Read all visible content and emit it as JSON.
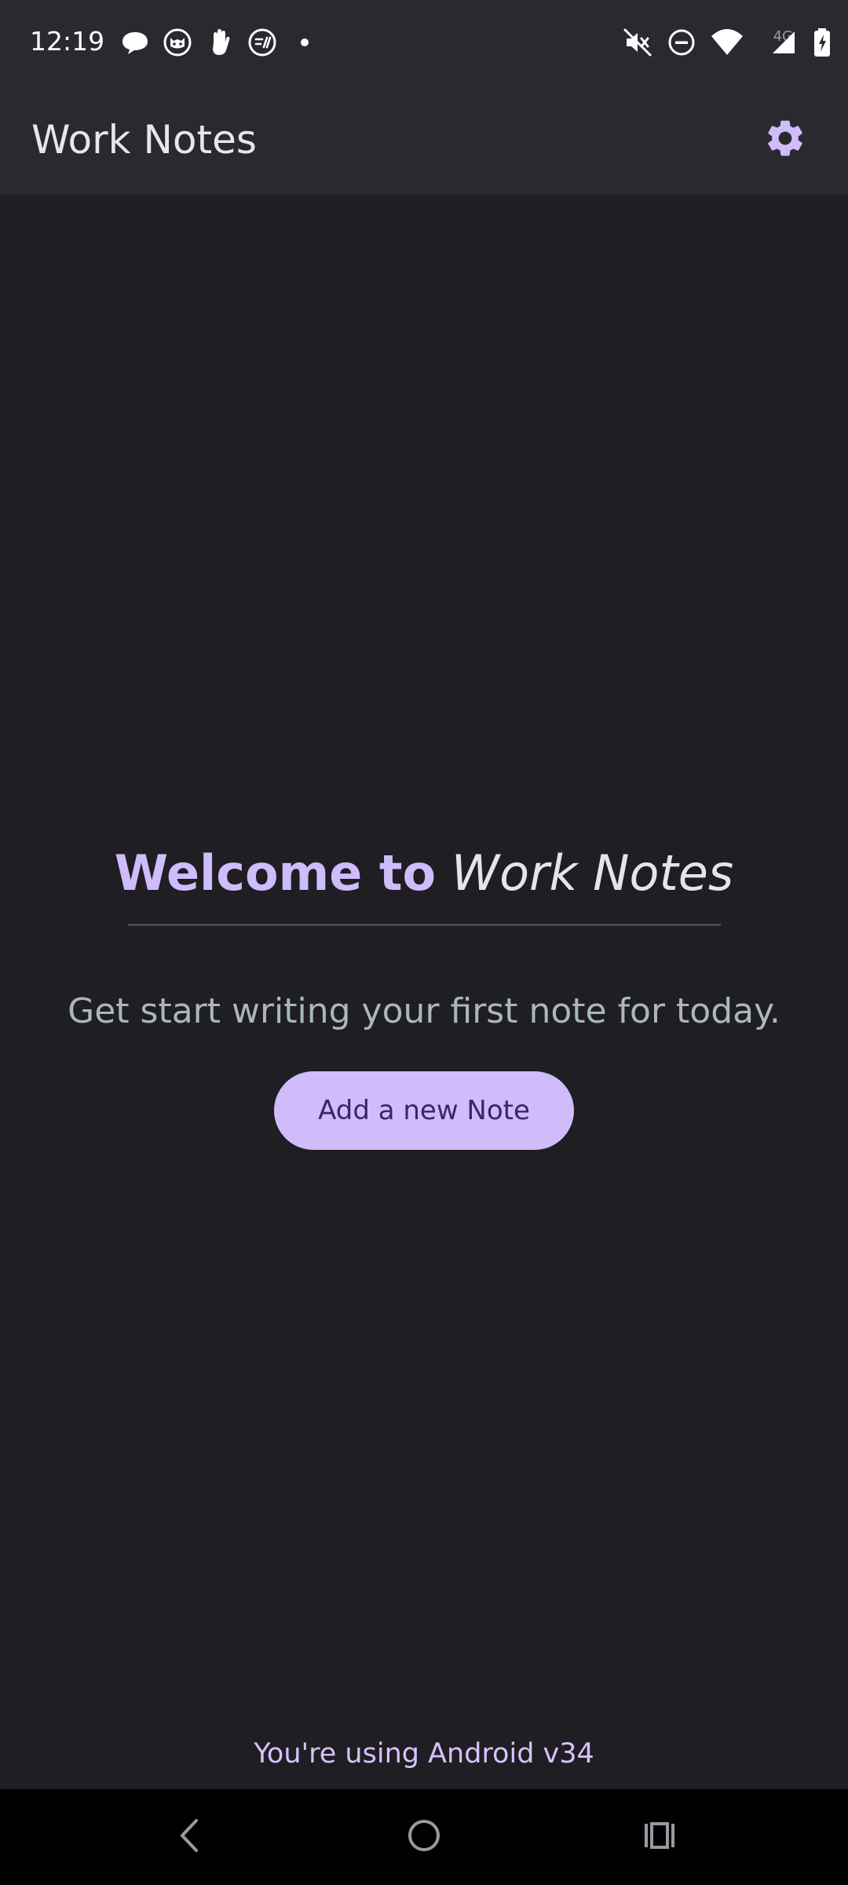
{
  "status_bar": {
    "time": "12:19",
    "network_label": "4G",
    "left_icons": [
      "chat-bubble-icon",
      "cat-face-icon",
      "hand-wave-icon",
      "circle-badge-icon",
      "dot-icon"
    ],
    "right_icons": [
      "mute-icon",
      "do-not-disturb-icon",
      "wifi-icon",
      "signal-icon",
      "battery-charging-icon"
    ]
  },
  "app_bar": {
    "title": "Work Notes",
    "settings_icon": "gear-icon"
  },
  "main": {
    "welcome_prefix": "Welcome to",
    "welcome_app_name": "Work Notes",
    "subtitle": "Get start writing your first note for today.",
    "add_note_label": "Add a new Note",
    "footer_text": "You're using Android v34"
  },
  "nav_bar": {
    "icons": [
      "back-icon",
      "home-icon",
      "recents-icon"
    ]
  },
  "colors": {
    "background": "#1f1e23",
    "app_bar": "#2b2930",
    "accent": "#cfbcfb",
    "button_bg": "#d0bcfb",
    "button_text": "#38266c",
    "subtitle": "#aab7bb"
  }
}
